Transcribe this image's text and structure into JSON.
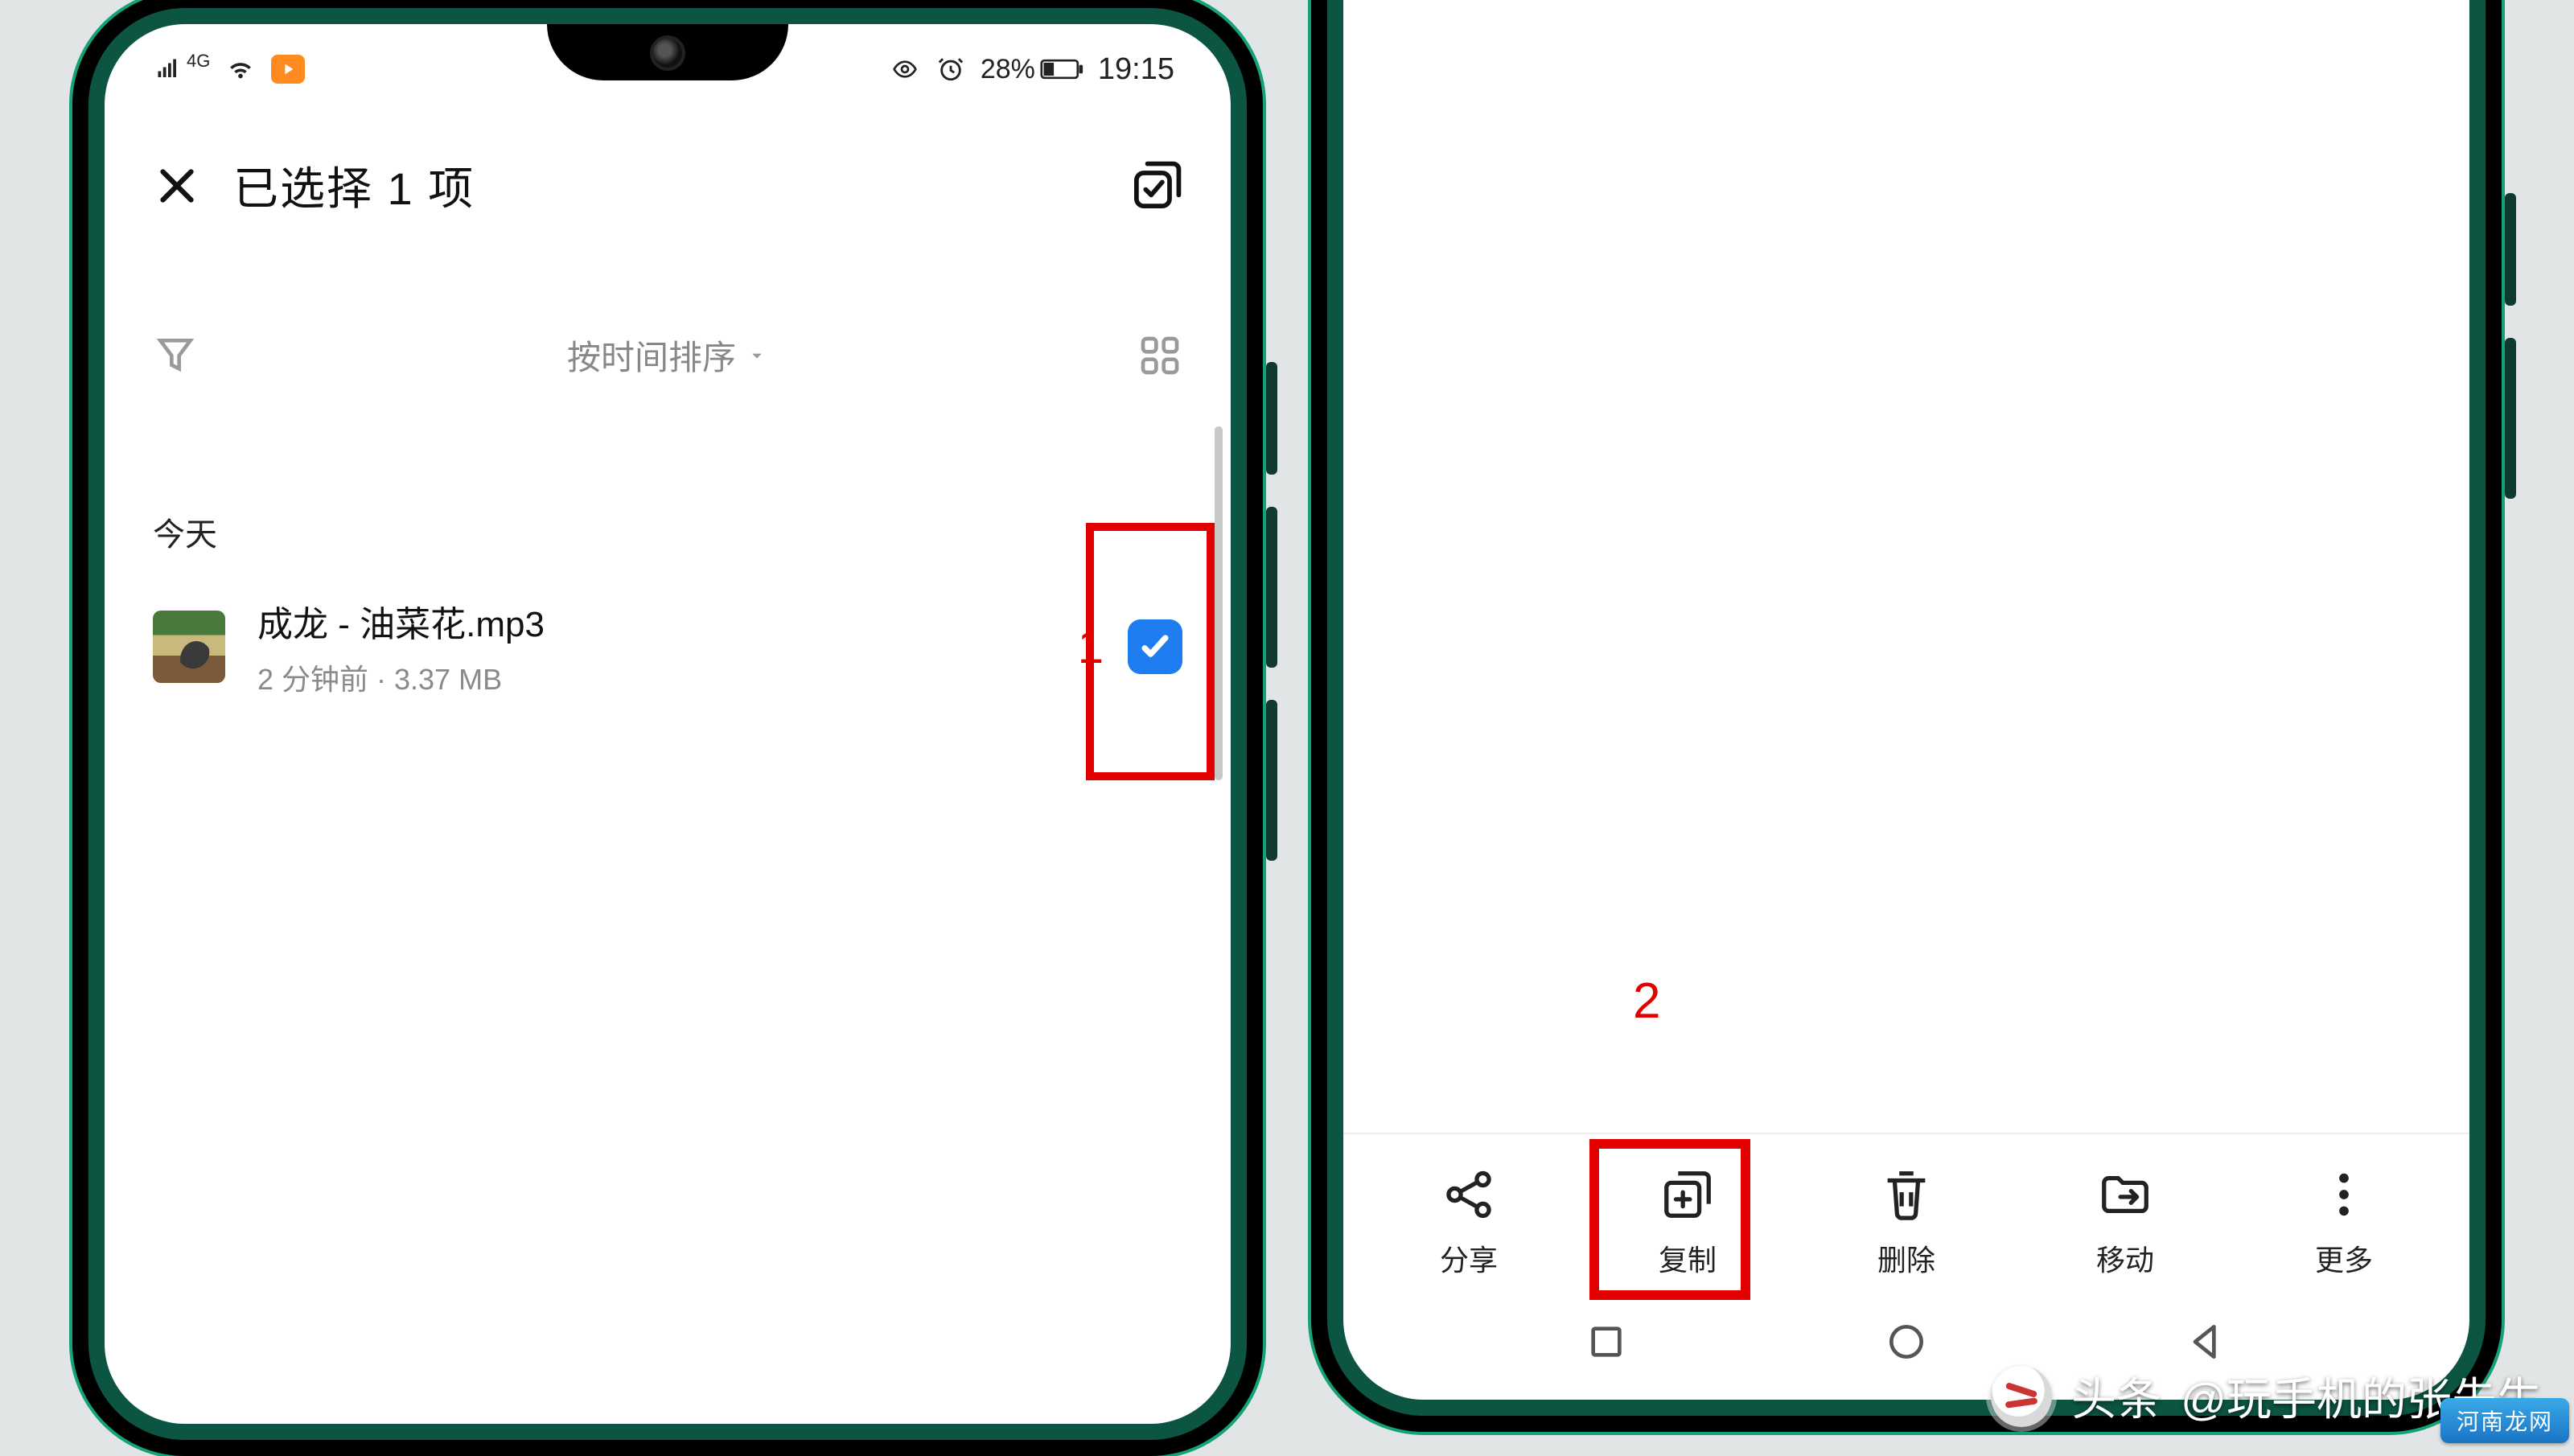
{
  "statusbar": {
    "network": "4G",
    "battery_pct": "28%",
    "time": "19:15"
  },
  "header": {
    "title": "已选择 1 项"
  },
  "sort": {
    "label": "按时间排序"
  },
  "section": {
    "today": "今天"
  },
  "file": {
    "name": "成龙 - 油菜花.mp3",
    "meta": "2 分钟前 · 3.37 MB"
  },
  "annotations": {
    "step1": "1",
    "step2": "2"
  },
  "actions": {
    "share": "分享",
    "copy": "复制",
    "delete": "删除",
    "move": "移动",
    "more": "更多"
  },
  "watermark": {
    "prefix": "头条",
    "handle": "@玩手机的张先生"
  },
  "corner_badge": "河南龙网"
}
